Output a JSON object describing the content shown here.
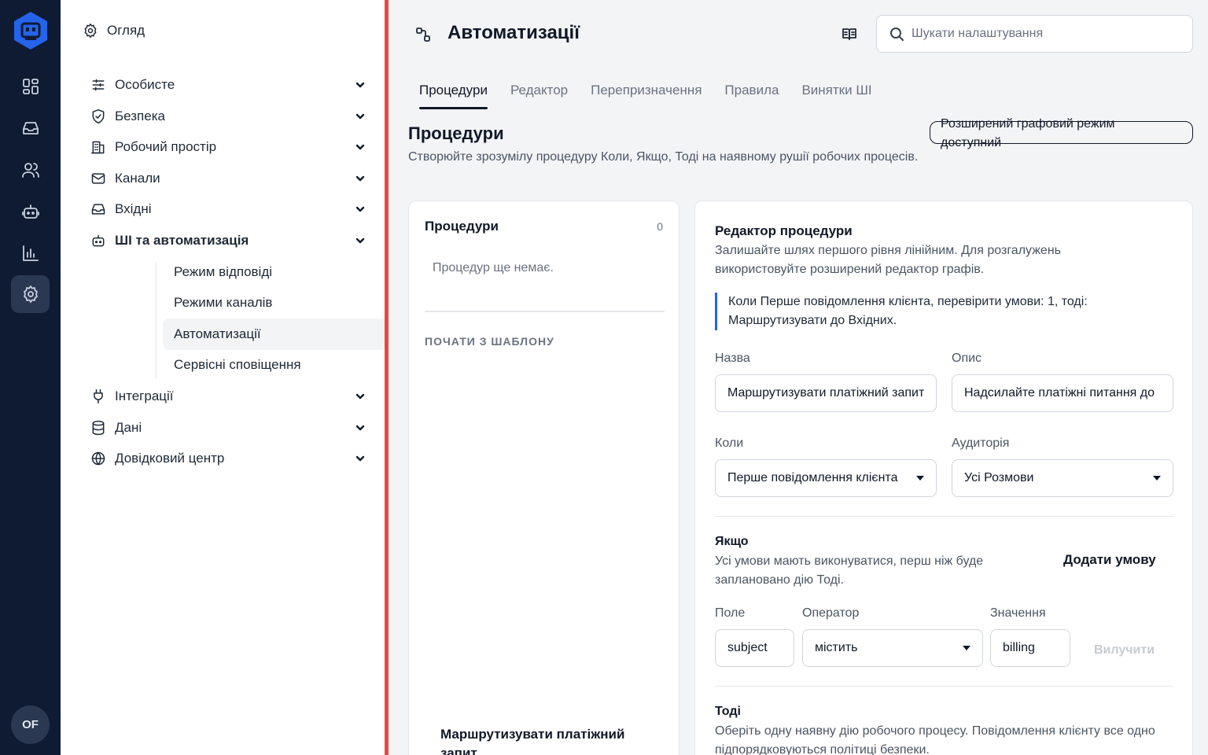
{
  "rail": {
    "items": [
      {
        "icon": "dashboard-icon"
      },
      {
        "icon": "inbox-icon"
      },
      {
        "icon": "contacts-icon"
      },
      {
        "icon": "bot-icon"
      },
      {
        "icon": "reports-icon"
      },
      {
        "icon": "settings-icon",
        "active": true
      }
    ],
    "avatar_initials": "OF"
  },
  "sidebar": {
    "overview": "Огляд",
    "sections": [
      {
        "label": "Особисте",
        "icon": "sliders-icon"
      },
      {
        "label": "Безпека",
        "icon": "shield-icon"
      },
      {
        "label": "Робочий простір",
        "icon": "building-icon"
      },
      {
        "label": "Канали",
        "icon": "mail-icon"
      },
      {
        "label": "Вхідні",
        "icon": "inbox-icon"
      },
      {
        "label": "ШІ та автоматизація",
        "icon": "bot-icon",
        "expanded": true
      },
      {
        "label": "Інтеграції",
        "icon": "plug-icon"
      },
      {
        "label": "Дані",
        "icon": "database-icon"
      },
      {
        "label": "Довідковий центр",
        "icon": "globe-icon"
      }
    ],
    "subitems": [
      "Режим відповіді",
      "Режими каналів",
      "Автоматизації",
      "Сервісні сповіщення"
    ],
    "active_subitem": "Автоматизації"
  },
  "header": {
    "title": "Автоматизації",
    "search_placeholder": "Шукати налаштування"
  },
  "tabs": [
    "Процедури",
    "Редактор",
    "Перепризначення",
    "Правила",
    "Винятки ШІ"
  ],
  "active_tab": "Процедури",
  "section": {
    "title": "Процедури",
    "description": "Створюйте зрозумілу процедуру Коли, Якщо, Тоді на наявному рушії робочих процесів.",
    "graph_mode": "Розширений графовий режим доступний"
  },
  "list_panel": {
    "title": "Процедури",
    "count": "0",
    "empty": "Процедур ще немає.",
    "template_heading": "ПОЧАТИ З ШАБЛОНУ",
    "template_item": "Маршрутизувати платіжний запит"
  },
  "editor": {
    "title": "Редактор процедури",
    "description": "Залишайте шлях першого рівня лінійним. Для розгалужень використовуйте розширений редактор графів.",
    "summary": "Коли Перше повідомлення клієнта, перевірити умови: 1, тоді: Маршрутизувати до Вхідних.",
    "name_label": "Назва",
    "name_value": "Маршрутизувати платіжний запит",
    "desc_label": "Опис",
    "desc_value": "Надсилайте платіжні питання до",
    "when_label": "Коли",
    "when_value": "Перше повідомлення клієнта",
    "audience_label": "Аудиторія",
    "audience_value": "Усі Розмови",
    "if_title": "Якщо",
    "if_desc": "Усі умови мають виконуватися, перш ніж буде заплановано дію Тоді.",
    "add_condition": "Додати умову",
    "field_label": "Поле",
    "operator_label": "Оператор",
    "value_label": "Значення",
    "condition_field": "subject",
    "condition_operator": "містить",
    "condition_value": "billing",
    "remove": "Вилучити",
    "then_title": "Тоді",
    "then_desc": "Оберіть одну наявну дію робочого процесу. Повідомлення клієнту все одно підпорядковуються політиці безпеки."
  }
}
